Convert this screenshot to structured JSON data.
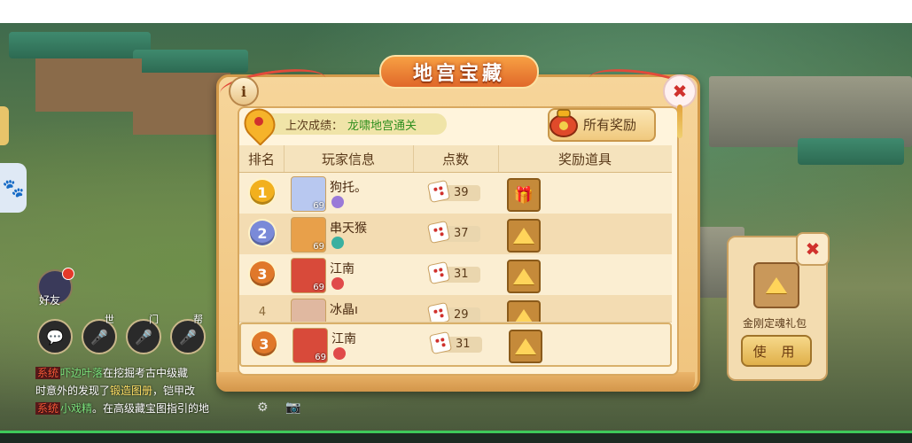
{
  "dialog": {
    "title": "地宫宝藏",
    "info_glyph": "i",
    "close_glyph": "✖",
    "last_result_label": "上次成绩：",
    "last_result_value": "龙啸地宫通关",
    "all_rewards_label": "所有奖励"
  },
  "table": {
    "headers": [
      "排名",
      "玩家信息",
      "点数",
      "奖励道具"
    ],
    "rows": [
      {
        "rank": "1",
        "name": "狗托。",
        "level": "69",
        "score": "39",
        "medal_color": "#f2b01e",
        "avatar_color": "#b8c8f0",
        "badge_color": "#9a7ad8",
        "reward": "gift-icon"
      },
      {
        "rank": "2",
        "name": "串天猴",
        "level": "69",
        "score": "37",
        "medal_color": "#7a8ad8",
        "avatar_color": "#e8a04a",
        "badge_color": "#3ab0a0",
        "reward": "cheese-icon"
      },
      {
        "rank": "3",
        "name": "江南",
        "level": "69",
        "score": "31",
        "medal_color": "#e0782a",
        "avatar_color": "#d84a3a",
        "badge_color": "#e04a4a",
        "reward": "cheese-icon"
      },
      {
        "rank": "4",
        "name": "冰晶ı",
        "level": "",
        "score": "29",
        "medal_color": "",
        "avatar_color": "#e0b8a0",
        "badge_color": "",
        "reward": "cheese-icon"
      }
    ],
    "my_row": {
      "rank": "3",
      "name": "江南",
      "level": "69",
      "score": "31",
      "medal_color": "#e0782a",
      "avatar_color": "#d84a3a",
      "badge_color": "#e04a4a",
      "reward": "cheese-icon"
    }
  },
  "right_popup": {
    "close_glyph": "✖",
    "item_name": "金刚定魂礼包",
    "use_label": "使 用"
  },
  "hud": {
    "friend_label": "好友",
    "voice_tags": [
      "世",
      "门",
      "帮"
    ],
    "chat_lines": [
      {
        "tag": "系统",
        "name": "吓边叶落",
        "text": "在挖掘考古中级藏"
      },
      {
        "tag": "",
        "name": "",
        "text": "时意外的发现了",
        "link": "锻造图册",
        "tail": "，铠甲改"
      },
      {
        "tag": "系统",
        "name": "小戏精",
        "text": "。在高级藏宝图指引的地"
      }
    ]
  }
}
